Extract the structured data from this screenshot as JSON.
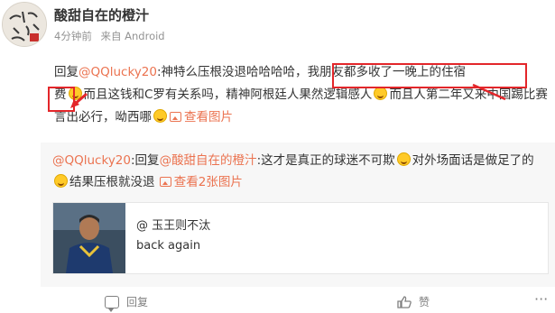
{
  "post": {
    "username": "酸甜自在的橙汁",
    "time": "4分钟前",
    "source": "来自 Android",
    "comment": {
      "reply_prefix": "回复",
      "mention": "@QQlucky20",
      "text_a": ":神特么压根没退哈哈哈哈，",
      "text_b": "我朋友都多收了一晚上的住宿",
      "text_c": "费",
      "text_d": "而且这钱和C罗有关系吗，精神阿根廷人果然逻辑感人",
      "text_e": "而且人第二年又来中国踢比赛言出必行，呦西哪",
      "view_images": "查看图片"
    }
  },
  "reply": {
    "mention": "@QQlucky20",
    "reply_word": ":回复",
    "mention2": "@酸甜自在的橙汁",
    "text_a": ":这才是真正的球迷不可欺",
    "text_b": "对外场面话是做足了的",
    "text_c": "结果压根就没退",
    "view_images": "查看2张图片",
    "card": {
      "title": "@ 玉王则不汰",
      "subtitle": "back again"
    }
  },
  "footer": {
    "reply_label": "回复",
    "like_label": "赞",
    "more": "···"
  },
  "colors": {
    "mention": "#eb7350",
    "highlight_box": "#e3262a",
    "reply_bg": "#f7f7f7"
  }
}
